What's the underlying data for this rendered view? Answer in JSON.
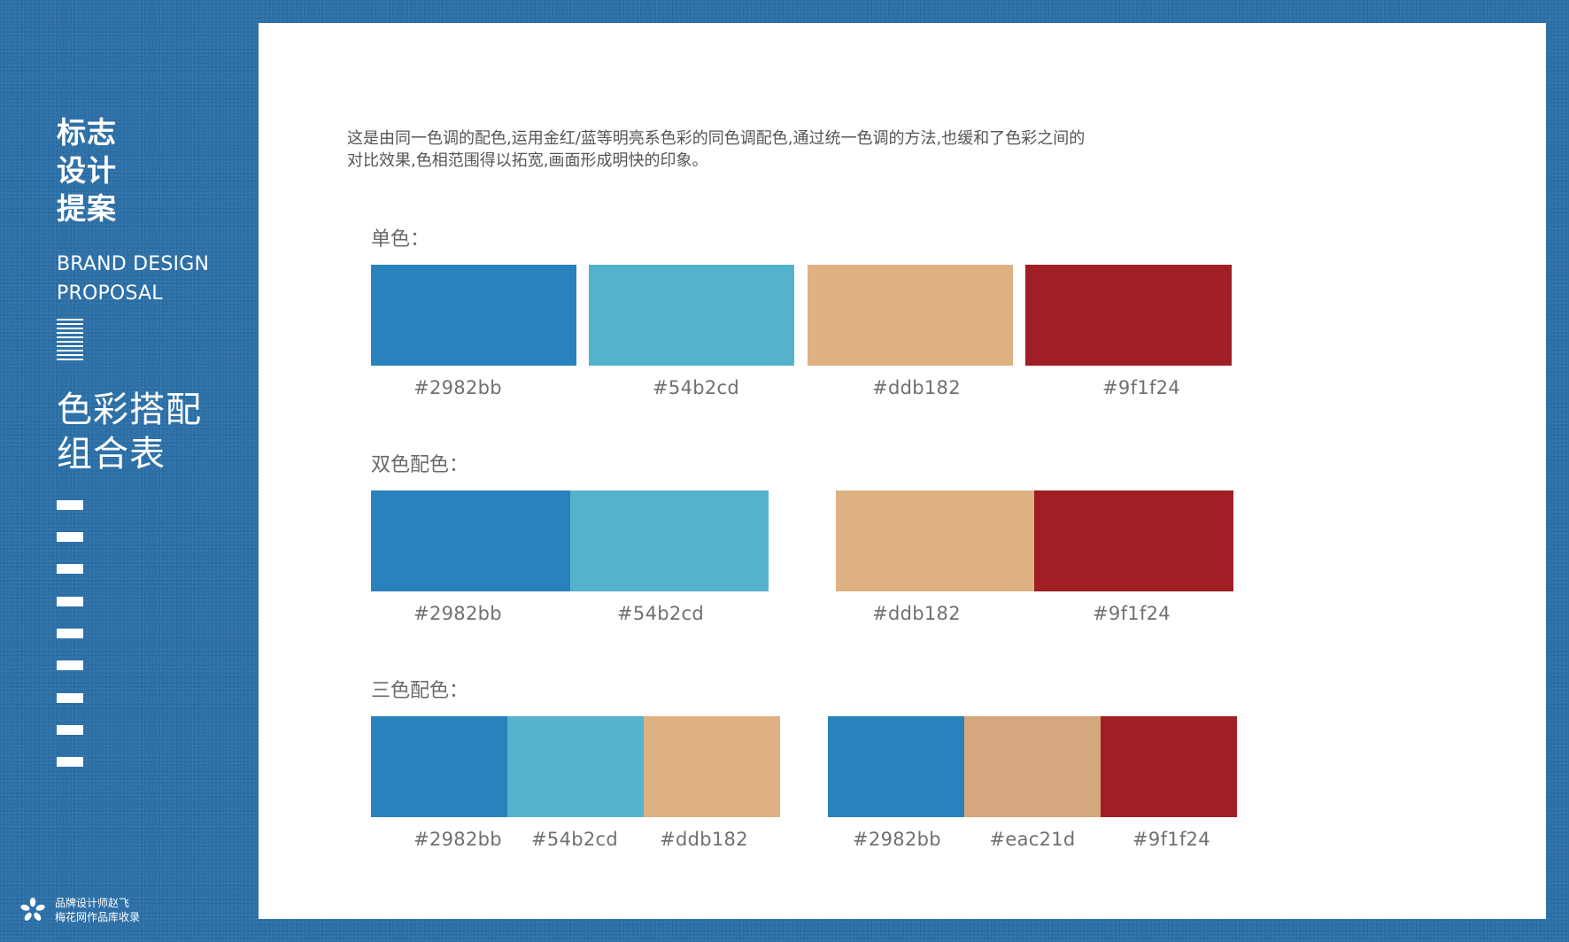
{
  "sidebar": {
    "title_lines": [
      "标志",
      "设计",
      "提案"
    ],
    "subtitle_lines": [
      "BRAND DESIGN",
      "PROPOSAL"
    ],
    "section_lines": [
      "色彩搭配",
      "组合表"
    ],
    "credit_lines": [
      "品牌设计师赵飞",
      "梅花网作品库收录"
    ]
  },
  "main": {
    "description_lines": [
      "这是由同一色调的配色,运用金红/蓝等明亮系色彩的同色调配色,通过统一色调的方法,也缓和了色彩之间的",
      "对比效果,色相范围得以拓宽,画面形成明快的印象。"
    ],
    "single": {
      "label": "单色：",
      "swatches": [
        {
          "hex": "#2982bb",
          "color": "#2982bb"
        },
        {
          "hex": "#54b2cd",
          "color": "#54b2cd"
        },
        {
          "hex": "#ddb182",
          "color": "#ddb182"
        },
        {
          "hex": "#9f1f24",
          "color": "#9f1f24"
        }
      ]
    },
    "double": {
      "label": "双色配色：",
      "groups": [
        [
          {
            "hex": "#2982bb",
            "color": "#2982bb"
          },
          {
            "hex": "#54b2cd",
            "color": "#54b2cd"
          }
        ],
        [
          {
            "hex": "#ddb182",
            "color": "#ddb182"
          },
          {
            "hex": "#9f1f24",
            "color": "#9f1f24"
          }
        ]
      ]
    },
    "triple": {
      "label": "三色配色：",
      "groups": [
        [
          {
            "hex": "#2982bb",
            "color": "#2982bb"
          },
          {
            "hex": "#54b2cd",
            "color": "#54b2cd"
          },
          {
            "hex": "#ddb182",
            "color": "#ddb182"
          }
        ],
        [
          {
            "hex": "#2982bb",
            "color": "#2982bb"
          },
          {
            "hex": "#eac21d",
            "color": "#d4a77e"
          },
          {
            "hex": "#9f1f24",
            "color": "#9f1f24"
          }
        ]
      ]
    }
  }
}
